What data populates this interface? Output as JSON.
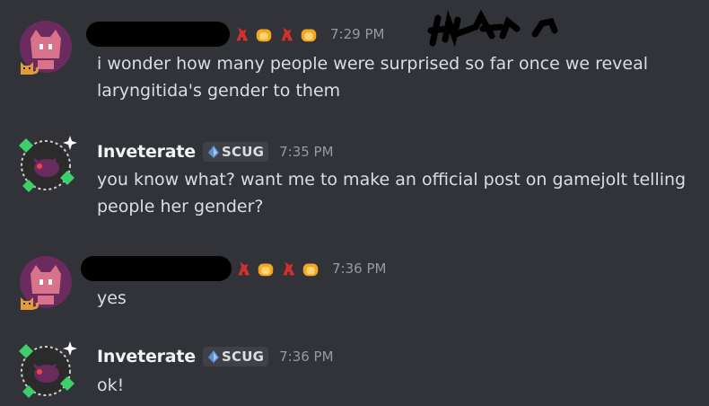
{
  "messages": [
    {
      "author": "",
      "author_redacted": true,
      "badges": [
        "cardinal-icon",
        "bread-icon",
        "cardinal-icon",
        "bread-icon"
      ],
      "timestamp": "7:29 PM",
      "text": "i wonder how many people were surprised so far once we reveal laryngitida's gender to them"
    },
    {
      "author": "Inveterate",
      "tag": "SCUG",
      "timestamp": "7:35 PM",
      "text": "you know what? want me to make an official post on gamejolt telling people her gender?"
    },
    {
      "author": "",
      "author_redacted": true,
      "badges": [
        "cardinal-icon",
        "bread-icon",
        "cardinal-icon",
        "bread-icon"
      ],
      "timestamp": "7:36 PM",
      "text": "yes"
    },
    {
      "author": "Inveterate",
      "tag": "SCUG",
      "timestamp": "7:36 PM",
      "text": "ok!"
    }
  ],
  "colors": {
    "background": "#313338",
    "username": "#f2f3f5",
    "text": "#dbdee1",
    "timestamp": "#949ba4",
    "tag_bg": "#3f4147",
    "avatar_pink": "#d9738c",
    "avatar_purple": "#6b2b5e"
  }
}
